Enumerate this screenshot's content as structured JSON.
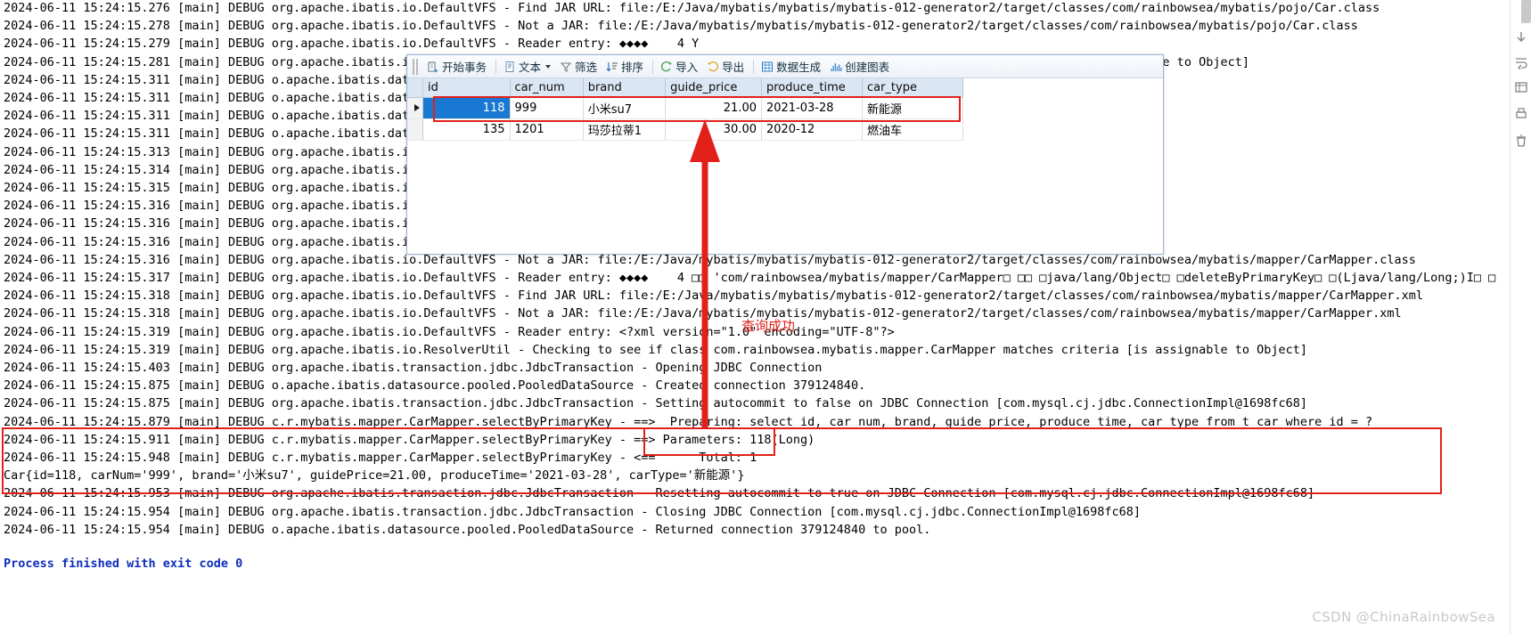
{
  "console": {
    "lines": [
      "2024-06-11 15:24:15.276 [main] DEBUG org.apache.ibatis.io.DefaultVFS - Find JAR URL: file:/E:/Java/mybatis/mybatis/mybatis-012-generator2/target/classes/com/rainbowsea/mybatis/pojo/Car.class",
      "2024-06-11 15:24:15.278 [main] DEBUG org.apache.ibatis.io.DefaultVFS - Not a JAR: file:/E:/Java/mybatis/mybatis/mybatis-012-generator2/target/classes/com/rainbowsea/mybatis/pojo/Car.class",
      "2024-06-11 15:24:15.279 [main] DEBUG org.apache.ibatis.io.DefaultVFS - Reader entry: ◆◆◆◆    4 Y",
      "2024-06-11 15:24:15.281 [main] DEBUG org.apache.ibatis.io.ResolverUtil - Checking to see if class com.rainbowsea.mybatis.pojo.Car matches criteria [is assignable to Object]",
      "2024-06-11 15:24:15.311 [main] DEBUG o.apache.ibatis.datasourc",
      "2024-06-11 15:24:15.311 [main] DEBUG o.apache.ibatis.datasourc",
      "2024-06-11 15:24:15.311 [main] DEBUG o.apache.ibatis.datasourc",
      "2024-06-11 15:24:15.311 [main] DEBUG o.apache.ibatis.datasourc",
      "2024-06-11 15:24:15.313 [main] DEBUG org.apache.ibatis.io.Defa",
      "2024-06-11 15:24:15.314 [main] DEBUG org.apache.ibatis.io.Defa",
      "2024-06-11 15:24:15.315 [main] DEBUG org.apache.ibatis.io.Defa",
      "2024-06-11 15:24:15.316 [main] DEBUG org.apache.ibatis.io.Defa",
      "2024-06-11 15:24:15.316 [main] DEBUG org.apache.ibatis.io.Defa",
      "2024-06-11 15:24:15.316 [main] DEBUG org.apache.ibatis.io.Defa",
      "2024-06-11 15:24:15.316 [main] DEBUG org.apache.ibatis.io.DefaultVFS - Not a JAR: file:/E:/Java/mybatis/mybatis/mybatis-012-generator2/target/classes/com/rainbowsea/mybatis/mapper/CarMapper.class",
      "2024-06-11 15:24:15.317 [main] DEBUG org.apache.ibatis.io.DefaultVFS - Reader entry: ◆◆◆◆    4 □□ 'com/rainbowsea/mybatis/mapper/CarMapper□ □□ □java/lang/Object□ □deleteByPrimaryKey□ □(Ljava/lang/Long;)I□ □",
      "2024-06-11 15:24:15.318 [main] DEBUG org.apache.ibatis.io.DefaultVFS - Find JAR URL: file:/E:/Java/mybatis/mybatis/mybatis-012-generator2/target/classes/com/rainbowsea/mybatis/mapper/CarMapper.xml",
      "2024-06-11 15:24:15.318 [main] DEBUG org.apache.ibatis.io.DefaultVFS - Not a JAR: file:/E:/Java/mybatis/mybatis/mybatis-012-generator2/target/classes/com/rainbowsea/mybatis/mapper/CarMapper.xml",
      "2024-06-11 15:24:15.319 [main] DEBUG org.apache.ibatis.io.DefaultVFS - Reader entry: <?xml version=\"1.0\" encoding=\"UTF-8\"?>",
      "2024-06-11 15:24:15.319 [main] DEBUG org.apache.ibatis.io.ResolverUtil - Checking to see if class com.rainbowsea.mybatis.mapper.CarMapper matches criteria [is assignable to Object]",
      "2024-06-11 15:24:15.403 [main] DEBUG org.apache.ibatis.transaction.jdbc.JdbcTransaction - Opening JDBC Connection",
      "2024-06-11 15:24:15.875 [main] DEBUG o.apache.ibatis.datasource.pooled.PooledDataSource - Created connection 379124840.",
      "2024-06-11 15:24:15.875 [main] DEBUG org.apache.ibatis.transaction.jdbc.JdbcTransaction - Setting autocommit to false on JDBC Connection [com.mysql.cj.jdbc.ConnectionImpl@1698fc68]",
      "2024-06-11 15:24:15.879 [main] DEBUG c.r.mybatis.mapper.CarMapper.selectByPrimaryKey - ==>  Preparing: select id, car_num, brand, guide_price, produce_time, car_type from t_car where id = ?",
      "2024-06-11 15:24:15.911 [main] DEBUG c.r.mybatis.mapper.CarMapper.selectByPrimaryKey - ==> Parameters: 118(Long)",
      "2024-06-11 15:24:15.948 [main] DEBUG c.r.mybatis.mapper.CarMapper.selectByPrimaryKey - <==      Total: 1",
      "Car{id=118, carNum='999', brand='小米su7', guidePrice=21.00, produceTime='2021-03-28', carType='新能源'}",
      "2024-06-11 15:24:15.953 [main] DEBUG org.apache.ibatis.transaction.jdbc.JdbcTransaction - Resetting autocommit to true on JDBC Connection [com.mysql.cj.jdbc.ConnectionImpl@1698fc68]",
      "2024-06-11 15:24:15.954 [main] DEBUG org.apache.ibatis.transaction.jdbc.JdbcTransaction - Closing JDBC Connection [com.mysql.cj.jdbc.ConnectionImpl@1698fc68]",
      "2024-06-11 15:24:15.954 [main] DEBUG o.apache.ibatis.datasource.pooled.PooledDataSource - Returned connection 379124840 to pool."
    ],
    "exit_line": "Process finished with exit code 0"
  },
  "grid": {
    "toolbar": [
      {
        "label": "开始事务",
        "icon": "transaction-icon",
        "caret": false
      },
      {
        "label": "文本",
        "icon": "text-icon",
        "caret": true
      },
      {
        "label": "筛选",
        "icon": "filter-icon",
        "caret": false
      },
      {
        "label": "排序",
        "icon": "sort-icon",
        "caret": false
      },
      {
        "label": "导入",
        "icon": "import-icon",
        "caret": false
      },
      {
        "label": "导出",
        "icon": "export-icon",
        "caret": false
      },
      {
        "label": "数据生成",
        "icon": "data-generate-icon",
        "caret": false
      },
      {
        "label": "创建图表",
        "icon": "create-chart-icon",
        "caret": false
      }
    ],
    "columns": [
      "id",
      "car_num",
      "brand",
      "guide_price",
      "produce_time",
      "car_type"
    ],
    "rows": [
      {
        "selected": true,
        "cells": [
          "118",
          "999",
          "小米su7",
          "21.00",
          "2021-03-28",
          "新能源"
        ]
      },
      {
        "selected": false,
        "cells": [
          "135",
          "1201",
          "玛莎拉蒂1",
          "30.00",
          "2020-12",
          "燃油车"
        ]
      }
    ]
  },
  "annotations": {
    "success_label": "查询成功"
  },
  "watermark": "CSDN @ChinaRainbowSea",
  "colors": {
    "annotation_red": "#e2201a",
    "selection_blue": "#1878d2",
    "header_blue": "#dbe6f4",
    "exit_blue": "#0d2dbb"
  }
}
